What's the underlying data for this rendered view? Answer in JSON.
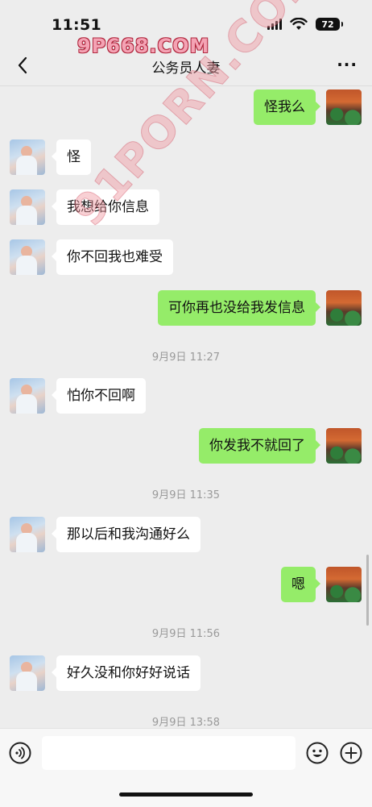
{
  "status": {
    "time": "11:51",
    "battery": "72"
  },
  "watermarks": {
    "top": "9P668.COM",
    "diagonal": "91PORN.COM"
  },
  "header": {
    "title": "公务员人妻",
    "more": "···"
  },
  "messages": [
    {
      "side": "right",
      "text": "怪我么"
    },
    {
      "side": "left",
      "text": "怪"
    },
    {
      "side": "left",
      "text": "我想给你信息"
    },
    {
      "side": "left",
      "text": "你不回我也难受"
    },
    {
      "side": "right",
      "text": "可你再也没给我发信息"
    },
    {
      "side": "left",
      "text": "怕你不回啊"
    },
    {
      "side": "right",
      "text": "你发我不就回了"
    },
    {
      "side": "left",
      "text": "那以后和我沟通好么"
    },
    {
      "side": "right",
      "text": "嗯"
    },
    {
      "side": "left",
      "text": "好久没和你好好说话"
    }
  ],
  "timestamps": [
    "9月9日 11:27",
    "9月9日 11:35",
    "9月9日 11:56",
    "9月9日 13:58"
  ],
  "input": {
    "value": ""
  },
  "colors": {
    "sent_bubble": "#95ec69",
    "received_bubble": "#ffffff",
    "background": "#ededed"
  }
}
